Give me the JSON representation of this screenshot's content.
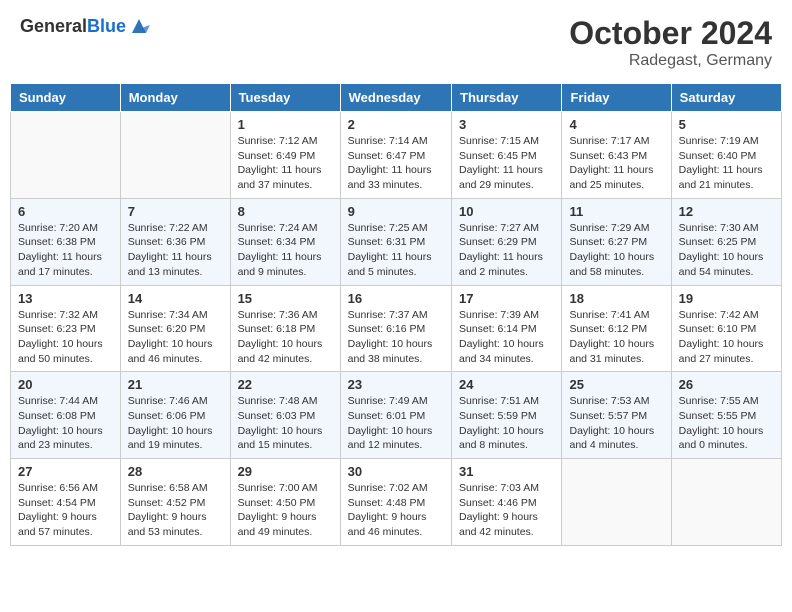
{
  "header": {
    "logo_general": "General",
    "logo_blue": "Blue",
    "month_title": "October 2024",
    "location": "Radegast, Germany"
  },
  "days_of_week": [
    "Sunday",
    "Monday",
    "Tuesday",
    "Wednesday",
    "Thursday",
    "Friday",
    "Saturday"
  ],
  "weeks": [
    [
      {
        "day": "",
        "info": ""
      },
      {
        "day": "",
        "info": ""
      },
      {
        "day": "1",
        "info": "Sunrise: 7:12 AM\nSunset: 6:49 PM\nDaylight: 11 hours and 37 minutes."
      },
      {
        "day": "2",
        "info": "Sunrise: 7:14 AM\nSunset: 6:47 PM\nDaylight: 11 hours and 33 minutes."
      },
      {
        "day": "3",
        "info": "Sunrise: 7:15 AM\nSunset: 6:45 PM\nDaylight: 11 hours and 29 minutes."
      },
      {
        "day": "4",
        "info": "Sunrise: 7:17 AM\nSunset: 6:43 PM\nDaylight: 11 hours and 25 minutes."
      },
      {
        "day": "5",
        "info": "Sunrise: 7:19 AM\nSunset: 6:40 PM\nDaylight: 11 hours and 21 minutes."
      }
    ],
    [
      {
        "day": "6",
        "info": "Sunrise: 7:20 AM\nSunset: 6:38 PM\nDaylight: 11 hours and 17 minutes."
      },
      {
        "day": "7",
        "info": "Sunrise: 7:22 AM\nSunset: 6:36 PM\nDaylight: 11 hours and 13 minutes."
      },
      {
        "day": "8",
        "info": "Sunrise: 7:24 AM\nSunset: 6:34 PM\nDaylight: 11 hours and 9 minutes."
      },
      {
        "day": "9",
        "info": "Sunrise: 7:25 AM\nSunset: 6:31 PM\nDaylight: 11 hours and 5 minutes."
      },
      {
        "day": "10",
        "info": "Sunrise: 7:27 AM\nSunset: 6:29 PM\nDaylight: 11 hours and 2 minutes."
      },
      {
        "day": "11",
        "info": "Sunrise: 7:29 AM\nSunset: 6:27 PM\nDaylight: 10 hours and 58 minutes."
      },
      {
        "day": "12",
        "info": "Sunrise: 7:30 AM\nSunset: 6:25 PM\nDaylight: 10 hours and 54 minutes."
      }
    ],
    [
      {
        "day": "13",
        "info": "Sunrise: 7:32 AM\nSunset: 6:23 PM\nDaylight: 10 hours and 50 minutes."
      },
      {
        "day": "14",
        "info": "Sunrise: 7:34 AM\nSunset: 6:20 PM\nDaylight: 10 hours and 46 minutes."
      },
      {
        "day": "15",
        "info": "Sunrise: 7:36 AM\nSunset: 6:18 PM\nDaylight: 10 hours and 42 minutes."
      },
      {
        "day": "16",
        "info": "Sunrise: 7:37 AM\nSunset: 6:16 PM\nDaylight: 10 hours and 38 minutes."
      },
      {
        "day": "17",
        "info": "Sunrise: 7:39 AM\nSunset: 6:14 PM\nDaylight: 10 hours and 34 minutes."
      },
      {
        "day": "18",
        "info": "Sunrise: 7:41 AM\nSunset: 6:12 PM\nDaylight: 10 hours and 31 minutes."
      },
      {
        "day": "19",
        "info": "Sunrise: 7:42 AM\nSunset: 6:10 PM\nDaylight: 10 hours and 27 minutes."
      }
    ],
    [
      {
        "day": "20",
        "info": "Sunrise: 7:44 AM\nSunset: 6:08 PM\nDaylight: 10 hours and 23 minutes."
      },
      {
        "day": "21",
        "info": "Sunrise: 7:46 AM\nSunset: 6:06 PM\nDaylight: 10 hours and 19 minutes."
      },
      {
        "day": "22",
        "info": "Sunrise: 7:48 AM\nSunset: 6:03 PM\nDaylight: 10 hours and 15 minutes."
      },
      {
        "day": "23",
        "info": "Sunrise: 7:49 AM\nSunset: 6:01 PM\nDaylight: 10 hours and 12 minutes."
      },
      {
        "day": "24",
        "info": "Sunrise: 7:51 AM\nSunset: 5:59 PM\nDaylight: 10 hours and 8 minutes."
      },
      {
        "day": "25",
        "info": "Sunrise: 7:53 AM\nSunset: 5:57 PM\nDaylight: 10 hours and 4 minutes."
      },
      {
        "day": "26",
        "info": "Sunrise: 7:55 AM\nSunset: 5:55 PM\nDaylight: 10 hours and 0 minutes."
      }
    ],
    [
      {
        "day": "27",
        "info": "Sunrise: 6:56 AM\nSunset: 4:54 PM\nDaylight: 9 hours and 57 minutes."
      },
      {
        "day": "28",
        "info": "Sunrise: 6:58 AM\nSunset: 4:52 PM\nDaylight: 9 hours and 53 minutes."
      },
      {
        "day": "29",
        "info": "Sunrise: 7:00 AM\nSunset: 4:50 PM\nDaylight: 9 hours and 49 minutes."
      },
      {
        "day": "30",
        "info": "Sunrise: 7:02 AM\nSunset: 4:48 PM\nDaylight: 9 hours and 46 minutes."
      },
      {
        "day": "31",
        "info": "Sunrise: 7:03 AM\nSunset: 4:46 PM\nDaylight: 9 hours and 42 minutes."
      },
      {
        "day": "",
        "info": ""
      },
      {
        "day": "",
        "info": ""
      }
    ]
  ]
}
